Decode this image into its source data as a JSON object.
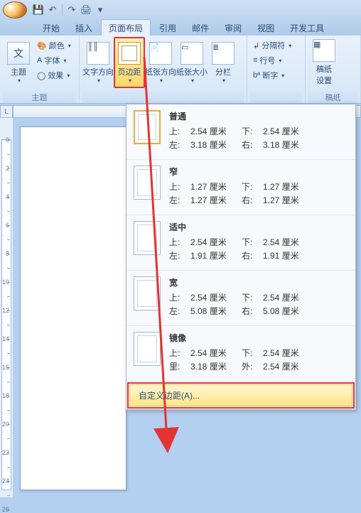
{
  "qat": {
    "save": "💾",
    "undo": "↶",
    "redo": "↷",
    "print": "🖨"
  },
  "tabs": {
    "home": "开始",
    "insert": "插入",
    "layout": "页面布局",
    "references": "引用",
    "mailings": "邮件",
    "review": "审阅",
    "view": "视图",
    "developer": "开发工具"
  },
  "ribbon": {
    "theme_group": "主题",
    "theme_btn": "主题",
    "color": "颜色",
    "font": "字体",
    "effect": "效果",
    "page_setup_items": {
      "text_dir": "文字方向",
      "margins": "页边距",
      "orientation": "纸张方向",
      "size": "纸张大小",
      "columns": "分栏"
    },
    "breaks": "分隔符",
    "line_num": "行号",
    "hyphen": "断字",
    "manuscript_group": "稿纸",
    "manuscript_btn": "稿纸\n设置"
  },
  "dropdown": {
    "presets": [
      {
        "key": "normal",
        "name": "普通",
        "top": "2.54 厘米",
        "bottom": "2.54 厘米",
        "left": "3.18 厘米",
        "right": "3.18 厘米",
        "l1": "上:",
        "l2": "下:",
        "l3": "左:",
        "l4": "右:"
      },
      {
        "key": "narrow",
        "name": "窄",
        "top": "1.27 厘米",
        "bottom": "1.27 厘米",
        "left": "1.27 厘米",
        "right": "1.27 厘米",
        "l1": "上:",
        "l2": "下:",
        "l3": "左:",
        "l4": "右:"
      },
      {
        "key": "moderate",
        "name": "适中",
        "top": "2.54 厘米",
        "bottom": "2.54 厘米",
        "left": "1.91 厘米",
        "right": "1.91 厘米",
        "l1": "上:",
        "l2": "下:",
        "l3": "左:",
        "l4": "右:"
      },
      {
        "key": "wide",
        "name": "宽",
        "top": "2.54 厘米",
        "bottom": "2.54 厘米",
        "left": "5.08 厘米",
        "right": "5.08 厘米",
        "l1": "上:",
        "l2": "下:",
        "l3": "左:",
        "l4": "右:"
      },
      {
        "key": "mirror",
        "name": "镜像",
        "top": "2.54 厘米",
        "bottom": "2.54 厘米",
        "left": "3.18 厘米",
        "right": "2.54 厘米",
        "l1": "上:",
        "l2": "下:",
        "l3": "里:",
        "l4": "外:"
      }
    ],
    "custom": "自定义边距(A)..."
  },
  "ruler_corner": "L",
  "colors": {
    "accent": "#e43333",
    "highlight": "#ffd76a"
  }
}
